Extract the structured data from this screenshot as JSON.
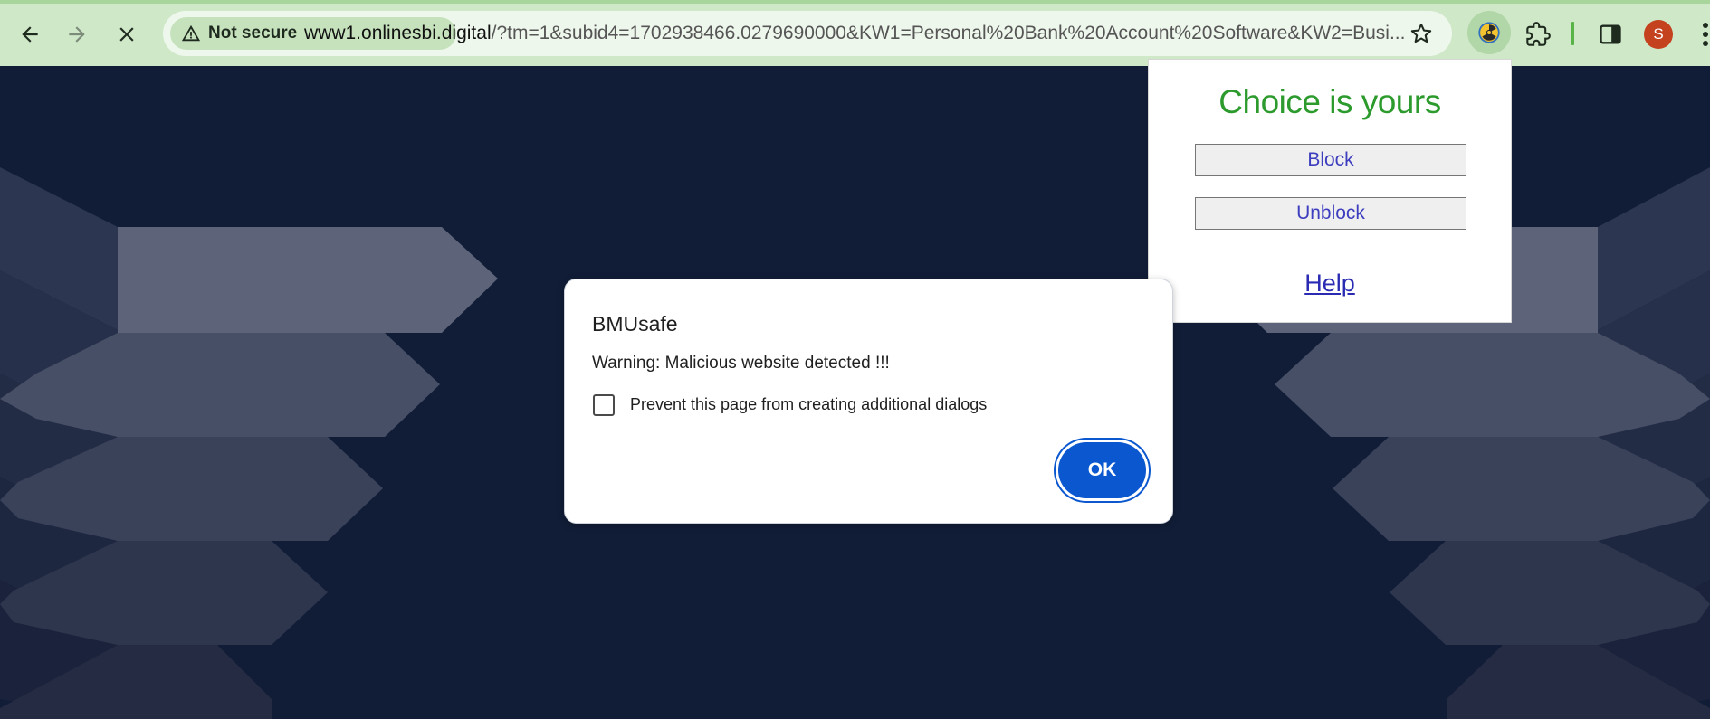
{
  "browser": {
    "security_label": "Not secure",
    "url_host": "www1.onlinesbi.digital",
    "url_path": "/?tm=1&subid4=1702938466.0279690000&KW1=Personal%20Bank%20Account%20Software&KW2=Busi...",
    "avatar_letter": "S",
    "theme_color": "#cfe8c8",
    "icons": {
      "back": "arrow-left-icon",
      "forward": "arrow-right-icon",
      "stop": "close-icon",
      "warning": "warning-triangle-icon",
      "bookmark": "star-icon",
      "extension_active": "radiation-icon",
      "extensions": "puzzle-icon",
      "side_panel": "side-panel-icon",
      "menu": "vertical-dots-icon"
    }
  },
  "extension_popup": {
    "title": "Choice is yours",
    "block_label": "Block",
    "unblock_label": "Unblock",
    "help_label": "Help",
    "title_color": "#2c9a2c"
  },
  "dialog": {
    "title": "BMUsafe",
    "message": "Warning: Malicious website detected !!!",
    "checkbox_label": "Prevent this page from creating additional dialogs",
    "checkbox_checked": false,
    "ok_label": "OK",
    "accent_color": "#0b57d0"
  }
}
